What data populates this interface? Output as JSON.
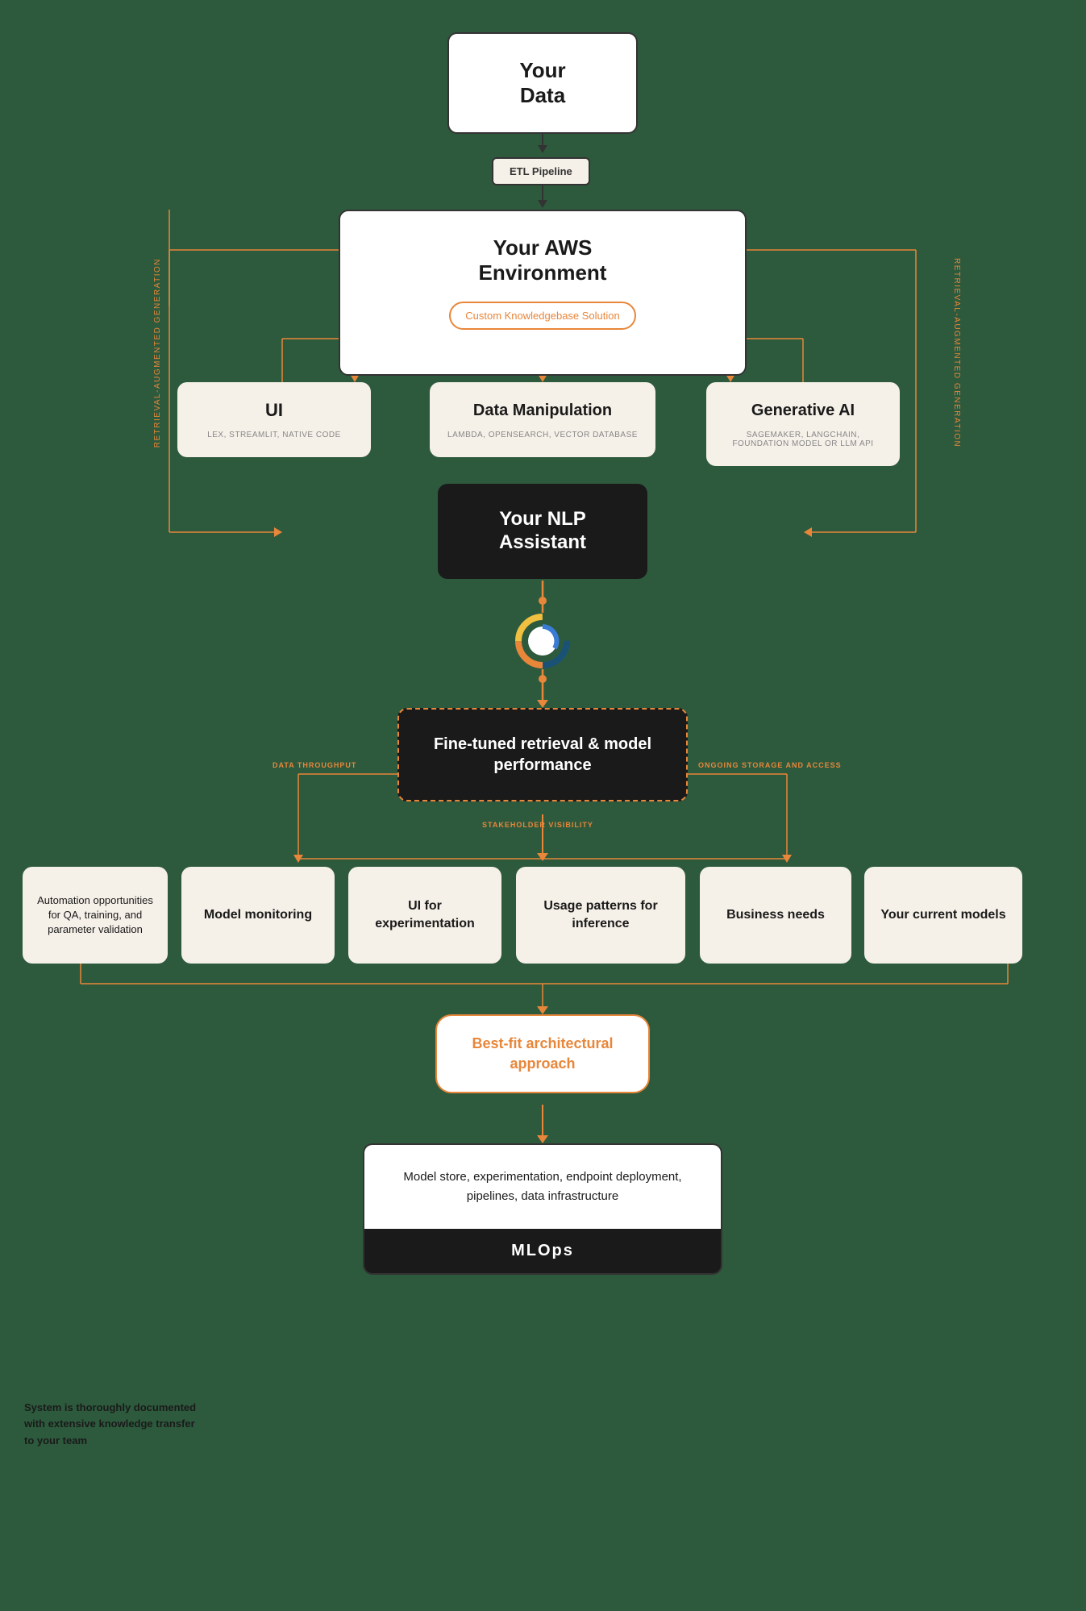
{
  "diagram": {
    "your_data": {
      "title": "Your",
      "title2": "Data"
    },
    "etl_pipeline": {
      "label": "ETL Pipeline"
    },
    "aws_env": {
      "title": "Your AWS",
      "title2": "Environment",
      "subtitle": "Custom Knowledgebase Solution"
    },
    "ui_box": {
      "title": "UI",
      "subtitle": "LEX, STREAMLIT, NATIVE CODE"
    },
    "data_manipulation": {
      "title": "Data Manipulation",
      "subtitle": "LAMBDA, OPENSEARCH, VECTOR DATABASE"
    },
    "generative_ai": {
      "title": "Generative AI",
      "subtitle": "SAGEMAKER, LANGCHAIN, FOUNDATION MODEL OR LLM API"
    },
    "nlp_assistant": {
      "title": "Your NLP",
      "title2": "Assistant"
    },
    "fine_tuned": {
      "title": "Fine-tuned retrieval & model performance",
      "label_left": "DATA THROUGHPUT",
      "label_right": "ONGOING STORAGE AND ACCESS",
      "label_bottom": "STAKEHOLDER VISIBILITY"
    },
    "side_label_left": "Retrieval-Augmented Generation",
    "side_label_right": "Retrieval-Augmented Generation",
    "bottom_cards": [
      {
        "id": "automation",
        "text": "Automation opportunities for QA, training, and parameter validation"
      },
      {
        "id": "model-monitoring",
        "text": "Model monitoring"
      },
      {
        "id": "ui-experimentation",
        "text": "UI for experimentation"
      },
      {
        "id": "usage-patterns",
        "text": "Usage patterns for inference"
      },
      {
        "id": "business-needs",
        "text": "Business needs"
      },
      {
        "id": "current-models",
        "text": "Your current models"
      }
    ],
    "best_fit": {
      "title": "Best-fit architectural approach"
    },
    "mlops_top": {
      "text": "Model store, experimentation, endpoint deployment, pipelines, data infrastructure"
    },
    "mlops_bottom": {
      "text": "MLOps"
    },
    "system_note": {
      "text": "System is thoroughly documented with extensive knowledge transfer to your team"
    }
  }
}
